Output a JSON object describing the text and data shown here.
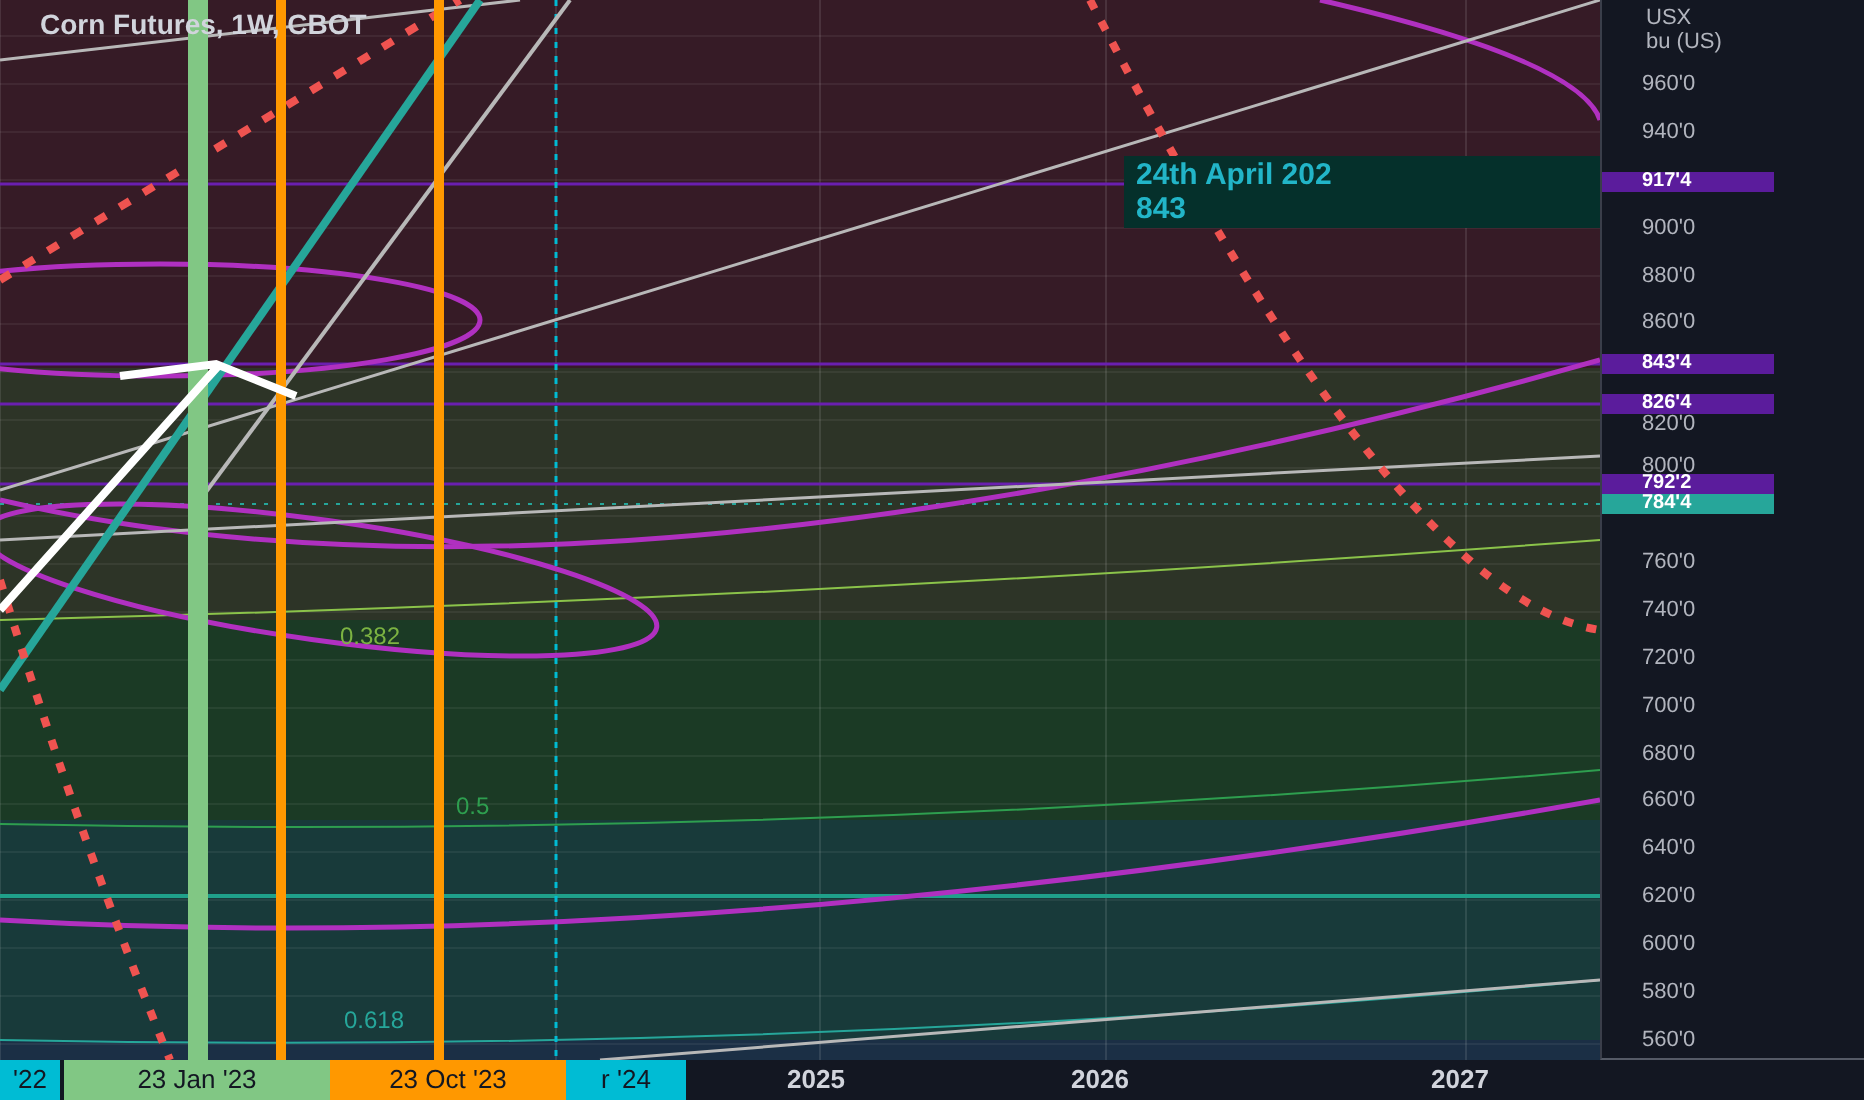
{
  "chart": {
    "title": "Corn Futures, 1W, CBOT",
    "fib_labels": [
      "0.382",
      "0.5",
      "0.618"
    ],
    "callout": {
      "date": "24th April 202",
      "value": "843"
    }
  },
  "price_axis": {
    "unit": [
      "USX",
      "bu (US)"
    ],
    "ticks": [
      "960'0",
      "940'0",
      "900'0",
      "880'0",
      "860'0",
      "820'0",
      "800'0",
      "760'0",
      "740'0",
      "720'0",
      "700'0",
      "680'0",
      "660'0",
      "640'0",
      "620'0",
      "600'0",
      "580'0",
      "560'0"
    ],
    "markers": [
      {
        "text": "917'4",
        "color": "#5b1c9c"
      },
      {
        "text": "843'4",
        "color": "#5b1c9c"
      },
      {
        "text": "826'4",
        "color": "#5b1c9c"
      },
      {
        "text": "792'2",
        "color": "#5b1c9c"
      },
      {
        "text": "784'4",
        "color": "#26a69a"
      }
    ]
  },
  "time_axis": {
    "markers": [
      {
        "text": "'22",
        "color": "#00bcd4"
      },
      {
        "text": "23 Jan '23",
        "color": "#81c784"
      },
      {
        "text": "23 Oct '23",
        "color": "#ff9800"
      },
      {
        "text": "r '24",
        "color": "#00bcd4"
      }
    ],
    "ticks": [
      "2025",
      "2026",
      "2027"
    ]
  }
}
